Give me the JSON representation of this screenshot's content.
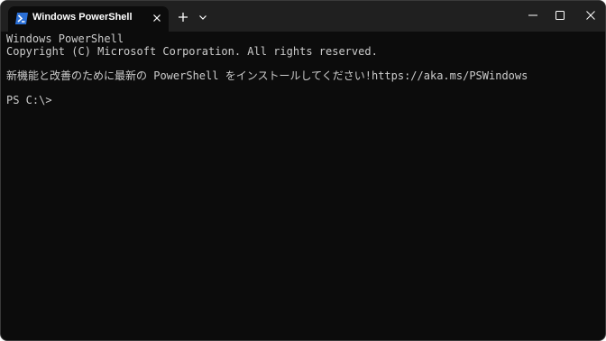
{
  "tab": {
    "title": "Windows PowerShell",
    "icon": "powershell-icon"
  },
  "window_controls": {
    "minimize_icon": "minimize-icon",
    "maximize_icon": "maximize-icon",
    "close_icon": "close-icon"
  },
  "console": {
    "line1": "Windows PowerShell",
    "line2": "Copyright (C) Microsoft Corporation. All rights reserved.",
    "line3": "新機能と改善のために最新の PowerShell をインストールしてください!https://aka.ms/PSWindows",
    "prompt": "PS C:\\>"
  },
  "colors": {
    "titlebar": "#202020",
    "console_bg": "#0c0c0c",
    "console_text": "#cccccc",
    "icon_blue": "#2a6fd6"
  }
}
